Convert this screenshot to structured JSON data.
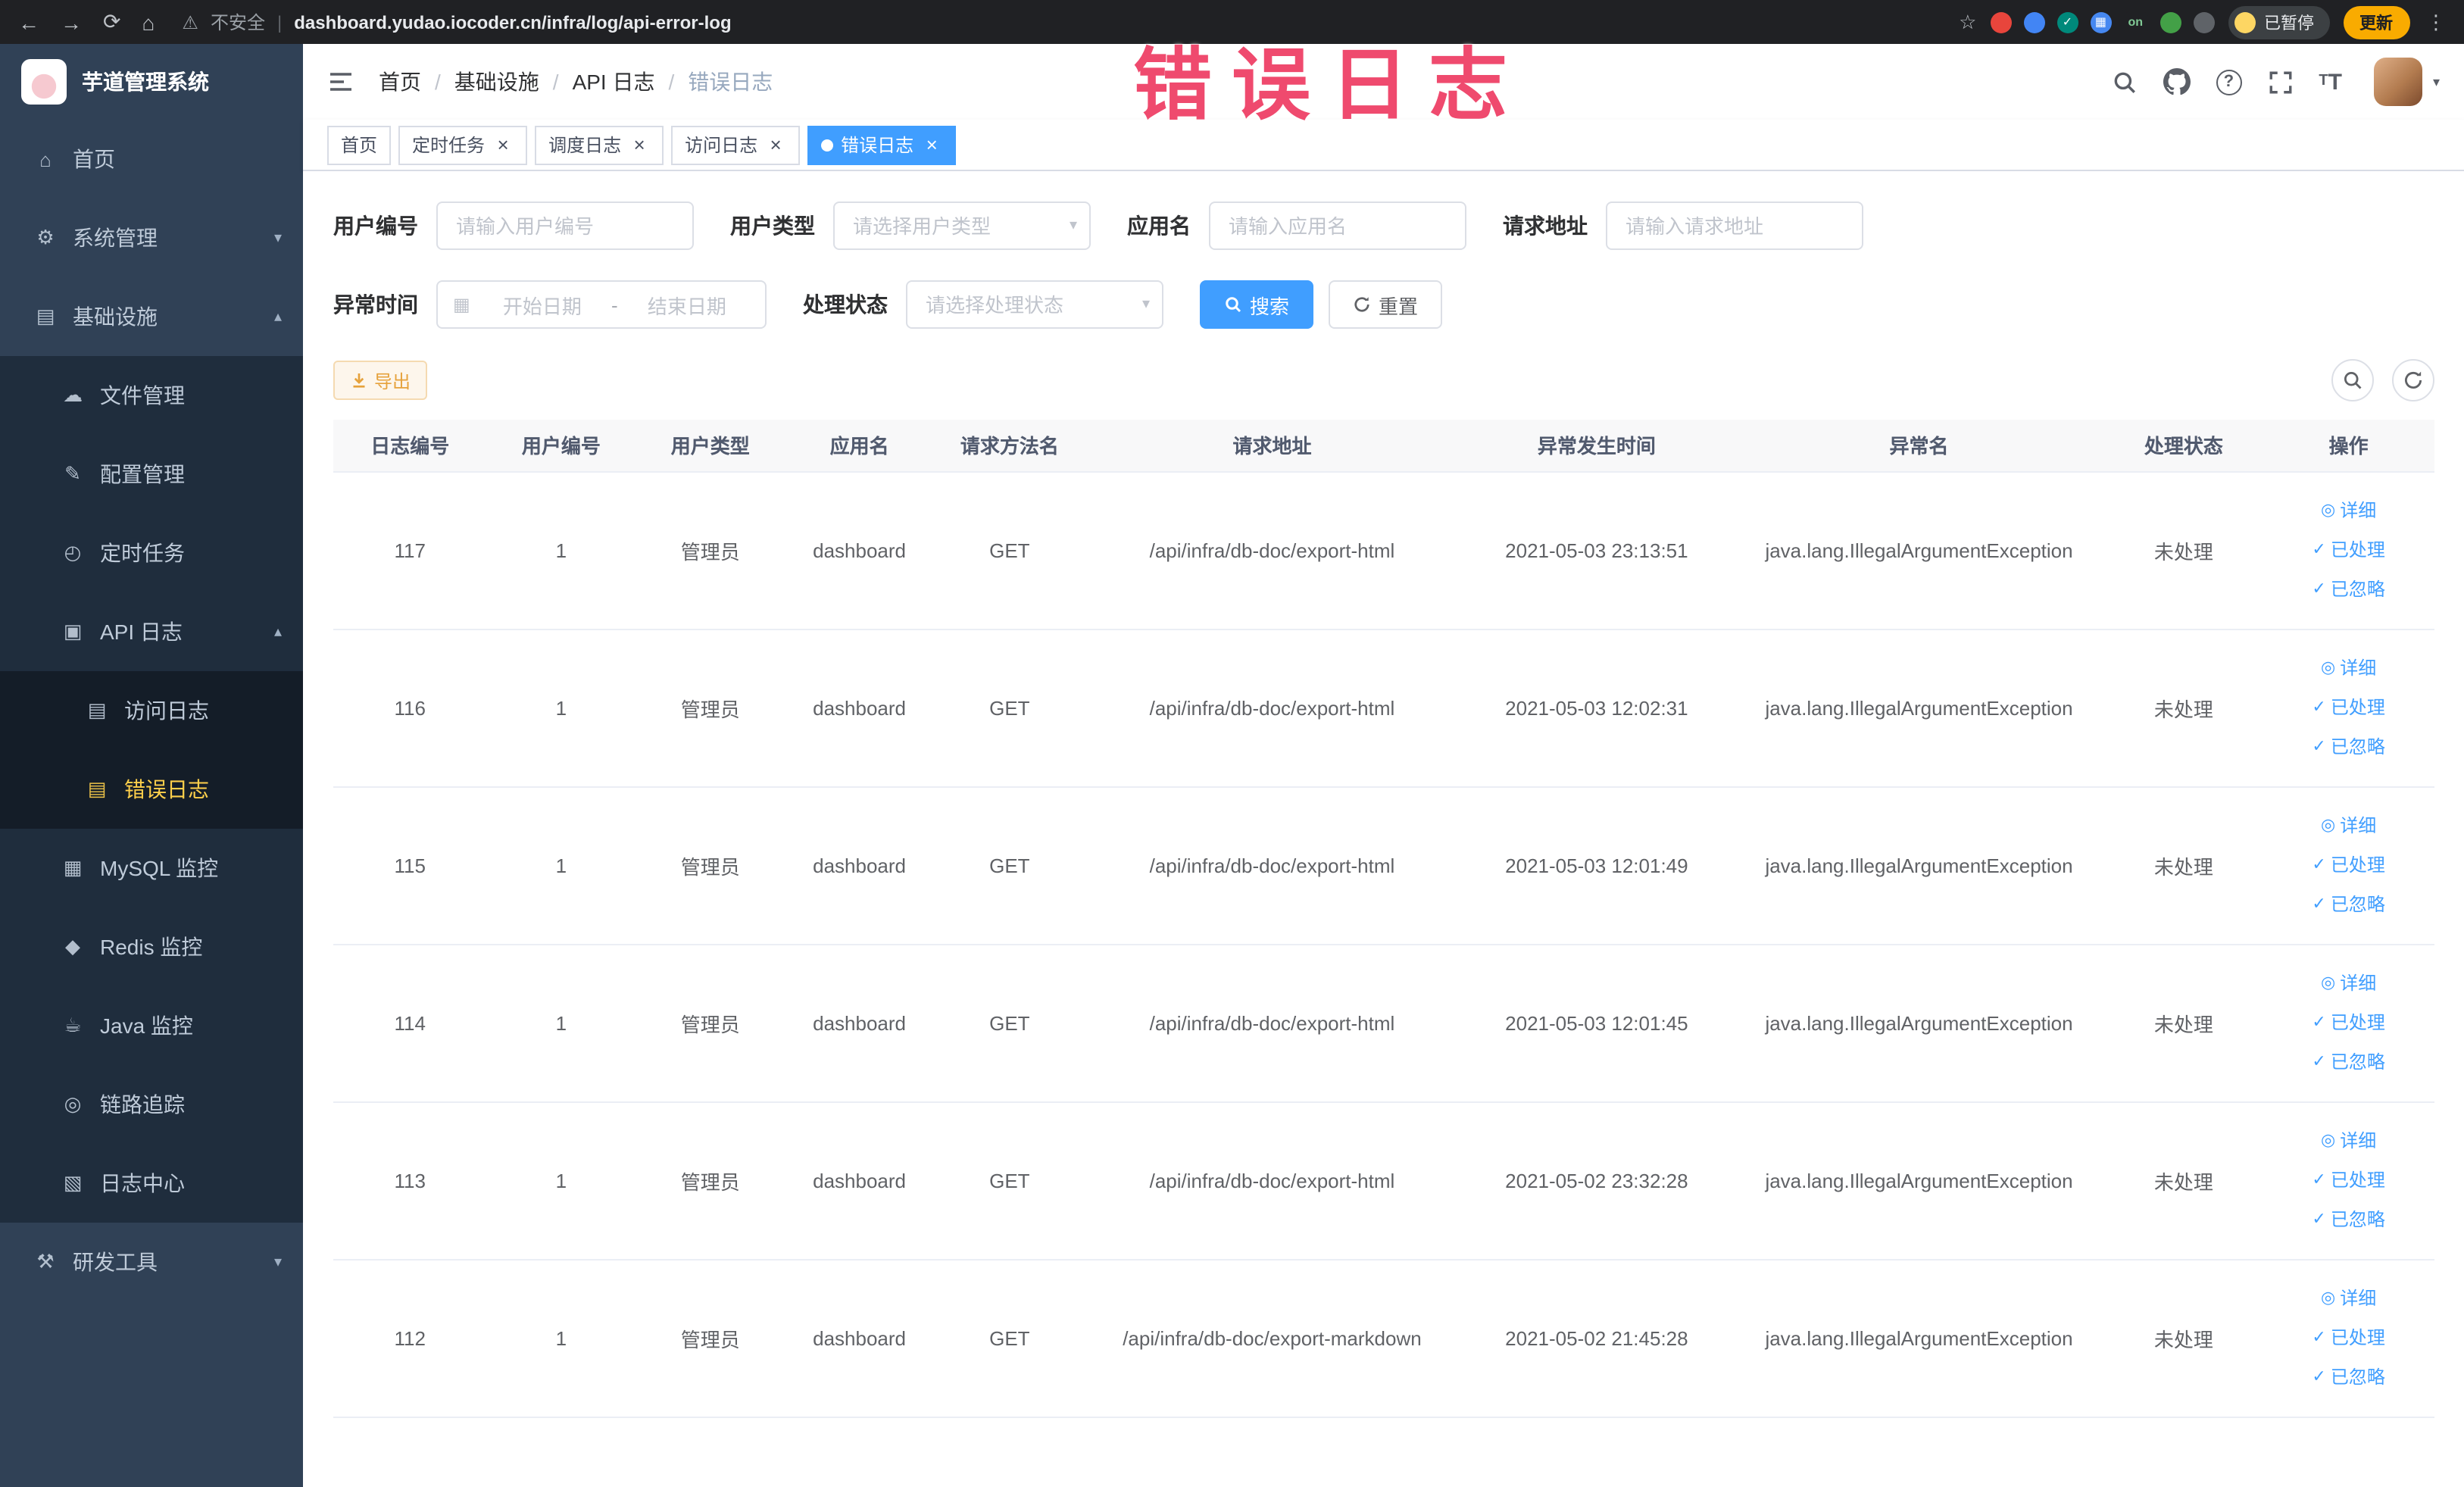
{
  "browser": {
    "security_label": "不安全",
    "url": "dashboard.yudao.iocoder.cn/infra/log/api-error-log",
    "paused_label": "已暂停",
    "update_label": "更新",
    "extensions": [
      {
        "name": "extension-red",
        "color": "#e8453c"
      },
      {
        "name": "extension-blue-drop",
        "color": "#4285f4"
      },
      {
        "name": "extension-teal-check",
        "color": "#00897b",
        "glyph": "✓"
      },
      {
        "name": "extension-blue-grid",
        "color": "#4688f1",
        "glyph": "▦"
      },
      {
        "name": "extension-on-badge",
        "color": "#202124",
        "glyph": "on",
        "fg": "#81c995"
      },
      {
        "name": "extension-green-plant",
        "color": "#43a047"
      },
      {
        "name": "extension-paw",
        "color": "#5f6368"
      }
    ]
  },
  "annotation": {
    "text": "错误日志"
  },
  "sidebar": {
    "logo_title": "芋道管理系统",
    "items": [
      {
        "id": "home",
        "label": "首页",
        "level": 1
      },
      {
        "id": "system-mgmt",
        "label": "系统管理",
        "level": 1,
        "chevron": "down"
      },
      {
        "id": "infra",
        "label": "基础设施",
        "level": 1,
        "chevron": "up"
      },
      {
        "id": "file-mgmt",
        "label": "文件管理",
        "level": 2
      },
      {
        "id": "config-mgmt",
        "label": "配置管理",
        "level": 2
      },
      {
        "id": "cron-job",
        "label": "定时任务",
        "level": 2
      },
      {
        "id": "api-log",
        "label": "API 日志",
        "level": 2,
        "chevron": "up"
      },
      {
        "id": "access-log",
        "label": "访问日志",
        "level": 3
      },
      {
        "id": "error-log",
        "label": "错误日志",
        "level": 3,
        "active": true
      },
      {
        "id": "mysql-monitor",
        "label": "MySQL 监控",
        "level": 2
      },
      {
        "id": "redis-monitor",
        "label": "Redis 监控",
        "level": 2
      },
      {
        "id": "java-monitor",
        "label": "Java 监控",
        "level": 2
      },
      {
        "id": "trace",
        "label": "链路追踪",
        "level": 2
      },
      {
        "id": "log-center",
        "label": "日志中心",
        "level": 2
      },
      {
        "id": "dev-tools",
        "label": "研发工具",
        "level": 1,
        "chevron": "down"
      }
    ]
  },
  "breadcrumb": {
    "items": [
      "首页",
      "基础设施",
      "API 日志",
      "错误日志"
    ]
  },
  "tabs": [
    {
      "id": "home",
      "label": "首页",
      "closable": false,
      "active": false
    },
    {
      "id": "cron-job",
      "label": "定时任务",
      "closable": true,
      "active": false
    },
    {
      "id": "schedule-log",
      "label": "调度日志",
      "closable": true,
      "active": false
    },
    {
      "id": "access-log",
      "label": "访问日志",
      "closable": true,
      "active": false
    },
    {
      "id": "error-log",
      "label": "错误日志",
      "closable": true,
      "active": true
    }
  ],
  "filters": {
    "user_id": {
      "label": "用户编号",
      "placeholder": "请输入用户编号"
    },
    "user_type": {
      "label": "用户类型",
      "placeholder": "请选择用户类型"
    },
    "app_name": {
      "label": "应用名",
      "placeholder": "请输入应用名"
    },
    "request_url": {
      "label": "请求地址",
      "placeholder": "请输入请求地址"
    },
    "exception_time": {
      "label": "异常时间",
      "start_placeholder": "开始日期",
      "separator": "-",
      "end_placeholder": "结束日期"
    },
    "process_status": {
      "label": "处理状态",
      "placeholder": "请选择处理状态"
    },
    "search_button": "搜索",
    "reset_button": "重置"
  },
  "toolbar": {
    "export_label": "导出"
  },
  "table": {
    "columns": [
      "日志编号",
      "用户编号",
      "用户类型",
      "应用名",
      "请求方法名",
      "请求地址",
      "异常发生时间",
      "异常名",
      "处理状态",
      "操作"
    ],
    "actions": [
      {
        "id": "detail",
        "label": "详细",
        "icon": "view"
      },
      {
        "id": "processed",
        "label": "已处理",
        "icon": "check"
      },
      {
        "id": "ignored",
        "label": "已忽略",
        "icon": "check"
      }
    ],
    "rows": [
      {
        "id": "117",
        "user_id": "1",
        "user_type": "管理员",
        "app": "dashboard",
        "method": "GET",
        "url": "/api/infra/db-doc/export-html",
        "time": "2021-05-03 23:13:51",
        "exception": "java.lang.IllegalArgumentException",
        "status": "未处理"
      },
      {
        "id": "116",
        "user_id": "1",
        "user_type": "管理员",
        "app": "dashboard",
        "method": "GET",
        "url": "/api/infra/db-doc/export-html",
        "time": "2021-05-03 12:02:31",
        "exception": "java.lang.IllegalArgumentException",
        "status": "未处理"
      },
      {
        "id": "115",
        "user_id": "1",
        "user_type": "管理员",
        "app": "dashboard",
        "method": "GET",
        "url": "/api/infra/db-doc/export-html",
        "time": "2021-05-03 12:01:49",
        "exception": "java.lang.IllegalArgumentException",
        "status": "未处理"
      },
      {
        "id": "114",
        "user_id": "1",
        "user_type": "管理员",
        "app": "dashboard",
        "method": "GET",
        "url": "/api/infra/db-doc/export-html",
        "time": "2021-05-03 12:01:45",
        "exception": "java.lang.IllegalArgumentException",
        "status": "未处理"
      },
      {
        "id": "113",
        "user_id": "1",
        "user_type": "管理员",
        "app": "dashboard",
        "method": "GET",
        "url": "/api/infra/db-doc/export-html",
        "time": "2021-05-02 23:32:28",
        "exception": "java.lang.IllegalArgumentException",
        "status": "未处理"
      },
      {
        "id": "112",
        "user_id": "1",
        "user_type": "管理员",
        "app": "dashboard",
        "method": "GET",
        "url": "/api/infra/db-doc/export-markdown",
        "time": "2021-05-02 21:45:28",
        "exception": "java.lang.IllegalArgumentException",
        "status": "未处理"
      }
    ]
  },
  "colors": {
    "accent": "#409eff",
    "sidebar_bg": "#304156",
    "sidebar_sub_bg": "#1f2d3d",
    "sidebar_sub2_bg": "#141d28",
    "sidebar_active": "#ffd04b",
    "warning": "#e6a23c",
    "annotation": "#ef4a6e"
  }
}
